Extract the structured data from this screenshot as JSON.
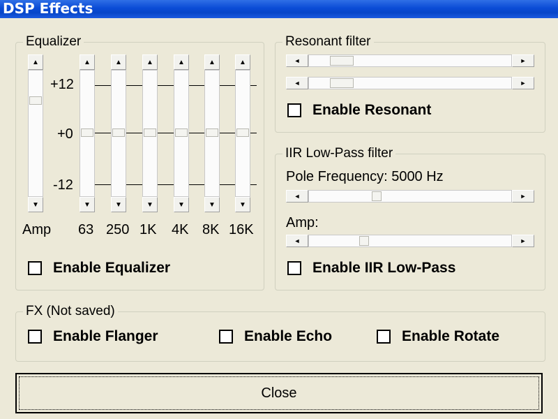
{
  "window": {
    "title": "DSP Effects"
  },
  "equalizer": {
    "title": "Equalizer",
    "db_labels": [
      "+12",
      "+0",
      "-12"
    ],
    "bands": [
      "Amp",
      "63",
      "250",
      "1K",
      "4K",
      "8K",
      "16K"
    ],
    "enable_label": "Enable Equalizer"
  },
  "resonant": {
    "title": "Resonant filter",
    "enable_label": "Enable Resonant"
  },
  "iir": {
    "title": "IIR Low-Pass filter",
    "pole_frequency_label": "Pole Frequency: 5000 Hz",
    "amp_label": "Amp:",
    "enable_label": "Enable IIR Low-Pass"
  },
  "fx": {
    "title": "FX (Not saved)",
    "flanger_label": "Enable Flanger",
    "echo_label": "Enable Echo",
    "rotate_label": "Enable Rotate"
  },
  "buttons": {
    "close_label": "Close"
  }
}
